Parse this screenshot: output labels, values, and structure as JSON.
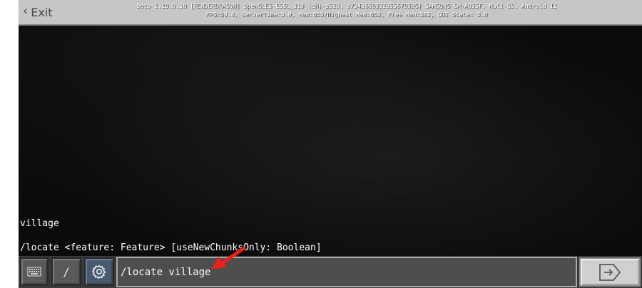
{
  "top_bar": {
    "exit_label": "Exit",
    "exit_icon": "chevron-left-icon",
    "debug_line_1": "beta 1.19.0.30 [RENDERDRAGON] OpenGLES ESSL_310 (cH)-p526, s734366983285567938G) SAMSUNG SM-A035F, Mali-G5, Android 11",
    "debug_line_2": "FPS:59.4, ServerTime:3.9, Mem:653/Highest Mem:653, Free Mem:382, GUI Scale: 3.0"
  },
  "chat": {
    "lines": [
      "village",
      "/locate <feature: Feature> [useNewChunksOnly: Boolean]"
    ]
  },
  "bottom_bar": {
    "keyboard_icon": "keyboard-icon",
    "slash_label": "/",
    "settings_icon": "gear-icon",
    "input_value": "/locate village",
    "send_icon": "send-icon"
  },
  "annotation": {
    "arrow_color": "#e8211a"
  },
  "colors": {
    "top_bar_bg": "#c6c6c6",
    "game_bg": "#0b0b0b",
    "input_bg": "#4e4e4e",
    "send_button_bg": "#d0d0d0",
    "settings_button_bg": "#4a5a6e"
  }
}
